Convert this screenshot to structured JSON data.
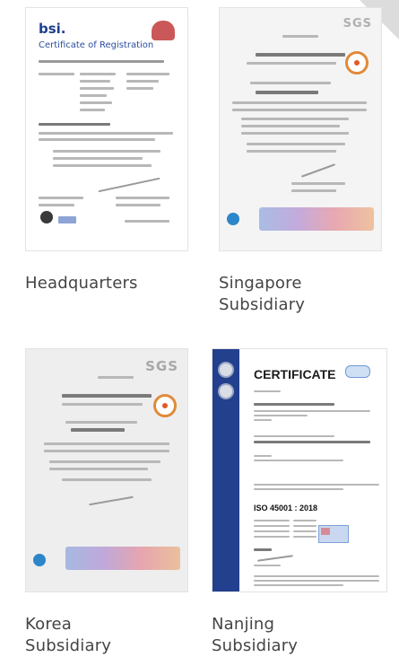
{
  "certificates": [
    {
      "id": "hq",
      "label_lines": [
        "Headquarters"
      ],
      "cert_title": "Certificate of Registration",
      "logo": "bsi."
    },
    {
      "id": "sg",
      "label_lines": [
        "Singapore",
        "Subsidiary"
      ],
      "logo": "SGS"
    },
    {
      "id": "kr",
      "label_lines": [
        "Korea",
        "Subsidiary"
      ],
      "logo": "SGS"
    },
    {
      "id": "nj",
      "label_lines": [
        "Nanjing",
        "Subsidiary"
      ],
      "cert_title": "CERTIFICATE",
      "standard": "ISO 45001 : 2018"
    }
  ]
}
